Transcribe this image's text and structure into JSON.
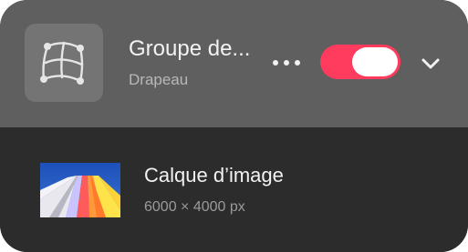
{
  "group": {
    "title": "Groupe de...",
    "subtitle": "Drapeau",
    "icon": "warp-mesh-icon",
    "visible": true,
    "expanded": true
  },
  "layer": {
    "title": "Calque d’image",
    "dimensions": "6000 × 4000 px",
    "thumbnail": "image-thumbnail"
  },
  "colors": {
    "toggle_on": "#ff3b5e",
    "group_bg": "#5f5f5f",
    "layer_bg": "#2c2c2c"
  }
}
